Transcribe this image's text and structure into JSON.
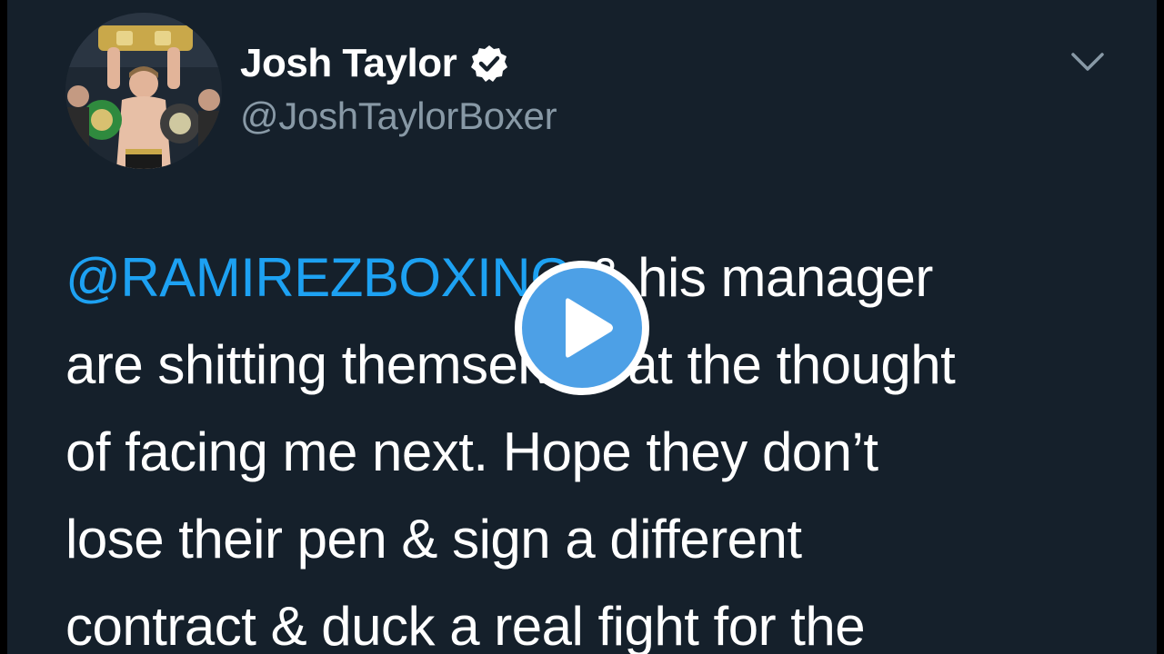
{
  "tweet": {
    "author": {
      "display_name": "Josh Taylor",
      "handle": "@JoshTaylorBoxer",
      "verified_icon": "verified-badge-icon",
      "avatar": "profile-photo-boxer-with-belts"
    },
    "more_icon": "chevron-down-icon",
    "lines": [
      {
        "mention": "@RAMIREZBOXING",
        "text": " & his manager"
      },
      {
        "text": "are shitting themselves at the thought"
      },
      {
        "text": "of facing me next. Hope they don’t"
      },
      {
        "text": "lose their pen & sign a different"
      },
      {
        "text": "contract & duck a real fight for the"
      }
    ]
  },
  "video": {
    "play_icon": "play-icon"
  },
  "colors": {
    "background": "#15202b",
    "mention": "#1da1f2",
    "handle": "#8899a6",
    "play_button": "#4da0e6"
  }
}
